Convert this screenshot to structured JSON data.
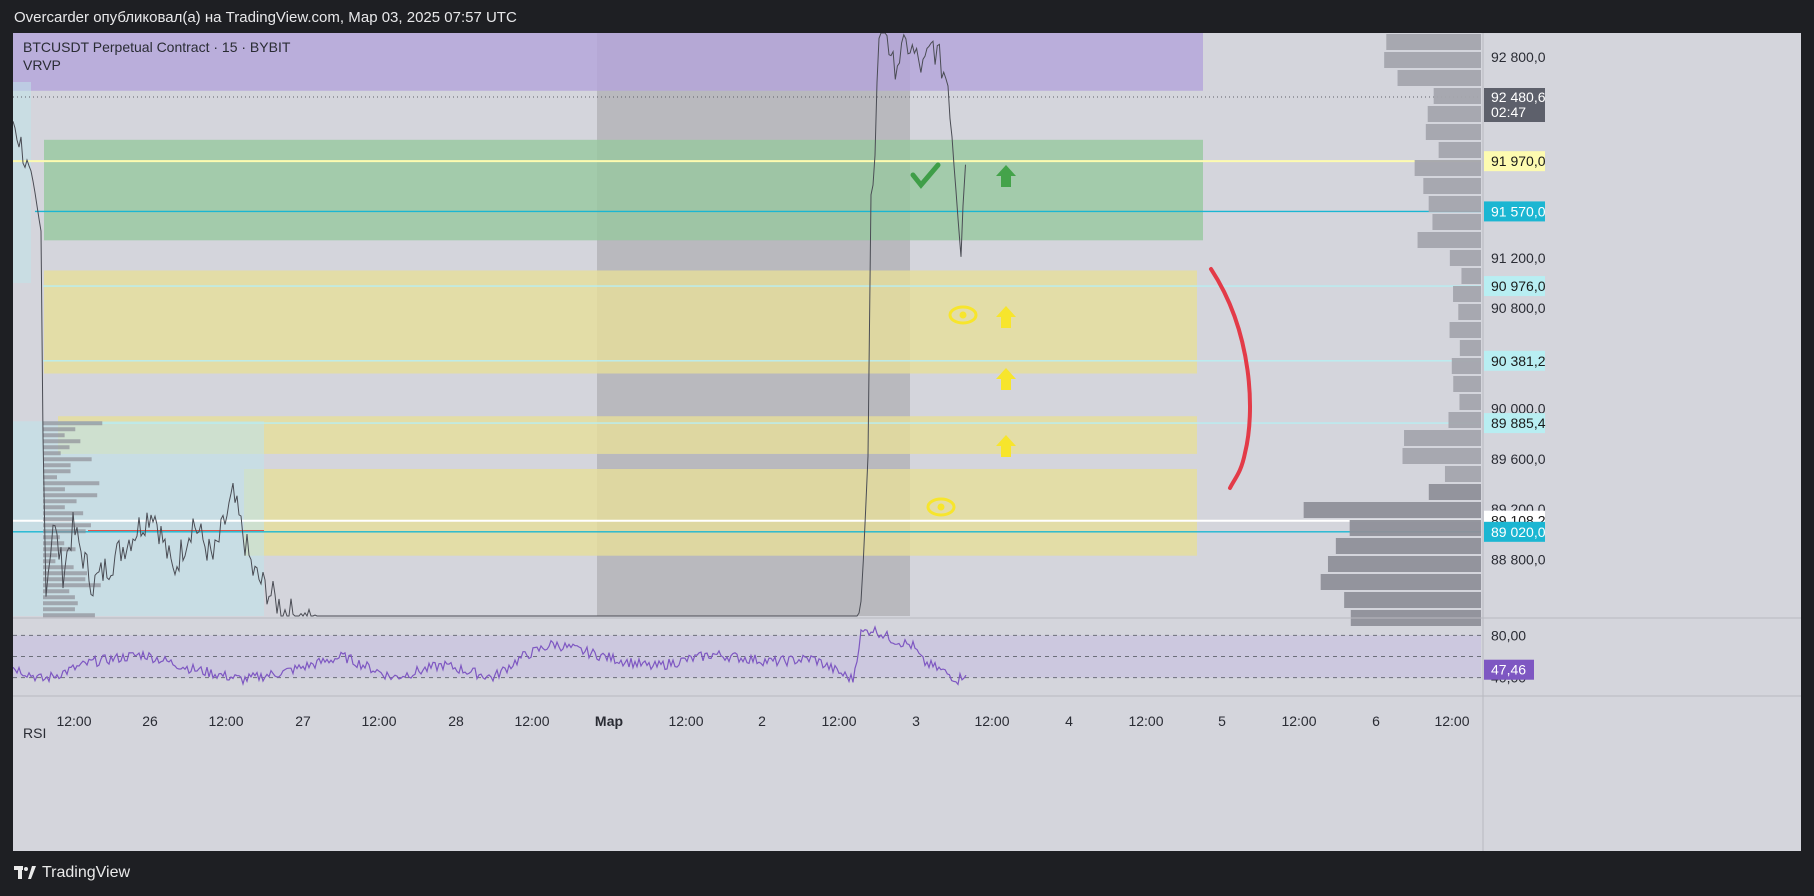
{
  "header": {
    "publisher_line": "Overcarder опубликовал(а) на TradingView.com, Мар 03, 2025 07:57 UTC"
  },
  "legend": {
    "symbol_line": "BTCUSDT Perpetual Contract · 15 · BYBIT",
    "indicator_line": "VRVP"
  },
  "rsi_pane": {
    "label": "RSI"
  },
  "footer": {
    "brand": "TradingView",
    "logo_icon": "tradingview-logo-icon"
  },
  "chart_data": {
    "type": "candlestick",
    "symbol": "BTCUSDT Perpetual Contract",
    "interval": "15",
    "exchange": "BYBIT",
    "price_range": [
      88350,
      92990
    ],
    "price_ticks": [
      {
        "label": "92 800,0",
        "value": 92800
      },
      {
        "label": "91 200,0",
        "value": 91200
      },
      {
        "label": "90 800,0",
        "value": 90800
      },
      {
        "label": "90 000,0",
        "value": 90000
      },
      {
        "label": "89 600,0",
        "value": 89600
      },
      {
        "label": "89 200,0",
        "value": 89200
      },
      {
        "label": "88 800,0",
        "value": 88800
      }
    ],
    "time_labels": [
      {
        "label": "12:00",
        "i": 0
      },
      {
        "label": "26",
        "i": 1
      },
      {
        "label": "12:00",
        "i": 2
      },
      {
        "label": "27",
        "i": 3
      },
      {
        "label": "12:00",
        "i": 4
      },
      {
        "label": "28",
        "i": 5
      },
      {
        "label": "12:00",
        "i": 6
      },
      {
        "label": "Мар",
        "i": 7,
        "bold": true
      },
      {
        "label": "12:00",
        "i": 8
      },
      {
        "label": "2",
        "i": 9
      },
      {
        "label": "12:00",
        "i": 10
      },
      {
        "label": "3",
        "i": 11
      },
      {
        "label": "12:00",
        "i": 12
      },
      {
        "label": "4",
        "i": 13
      },
      {
        "label": "12:00",
        "i": 14
      },
      {
        "label": "5",
        "i": 15
      },
      {
        "label": "12:00",
        "i": 16
      },
      {
        "label": "6",
        "i": 17
      },
      {
        "label": "12:00",
        "i": 18
      }
    ],
    "current_price": {
      "label": "92 480,6",
      "countdown": "02:47",
      "value": 92480.6,
      "color": "#5d606b"
    },
    "levels": [
      {
        "label": "91 970,0",
        "value": 91970,
        "color": "#fdfbb0",
        "text_color": "#1a1a1a"
      },
      {
        "label": "91 570,0",
        "value": 91570,
        "color": "#1bb6d2",
        "text_color": "#ffffff"
      },
      {
        "label": "90 976,0",
        "value": 90976,
        "color": "#b8eef2",
        "text_color": "#1a1a1a"
      },
      {
        "label": "90 381,2",
        "value": 90381.2,
        "color": "#b8eef2",
        "text_color": "#1a1a1a"
      },
      {
        "label": "89 885,4",
        "value": 89885.4,
        "color": "#b8eef2",
        "text_color": "#1a1a1a"
      },
      {
        "label": "89 108,2",
        "value": 89108.2,
        "color": "#ffffff",
        "text_color": "#1a1a1a"
      },
      {
        "label": "89 020,0",
        "value": 89020,
        "color": "#1bb6d2",
        "text_color": "#ffffff"
      }
    ],
    "zones": [
      {
        "name": "supply-zone-purple",
        "from": 92990,
        "to": 92530,
        "color": "#b5a5db"
      },
      {
        "name": "demand-zone-green",
        "from": 92140,
        "to": 91340,
        "color": "#98c8a0"
      },
      {
        "name": "demand-zone-yellow-1",
        "from": 91100,
        "to": 90280,
        "color": "#e6de9b"
      },
      {
        "name": "demand-zone-yellow-2",
        "from": 89940,
        "to": 89640,
        "color": "#e6de9b"
      },
      {
        "name": "demand-zone-yellow-3",
        "from": 89520,
        "to": 88830,
        "color": "#e6de9b"
      }
    ],
    "weekend_shade": {
      "from_label": "28 12:00",
      "to_label": "3",
      "color": "#b4b4b8"
    },
    "rsi": {
      "levels": [
        {
          "label": "80,00",
          "value": 80
        },
        {
          "label": "40,00",
          "value": 40
        }
      ],
      "range": [
        32,
        88
      ],
      "current": {
        "label": "47,46",
        "value": 47.46,
        "color": "#7e57c2"
      },
      "line_color": "#7e57c2"
    },
    "annotations": {
      "checkmark_color": "#3f9e48",
      "up_arrow_green": "#44a34a",
      "up_arrow_yellow": "#f7e52c",
      "eye_icon_color": "#f7e52c",
      "brace_color": "#e33b48"
    },
    "colors": {
      "background": "#d4d5dc",
      "volume_profile": "#a4a5ad",
      "volume_profile_value_area": "#8f9099",
      "price_line": "#5e6068"
    }
  }
}
